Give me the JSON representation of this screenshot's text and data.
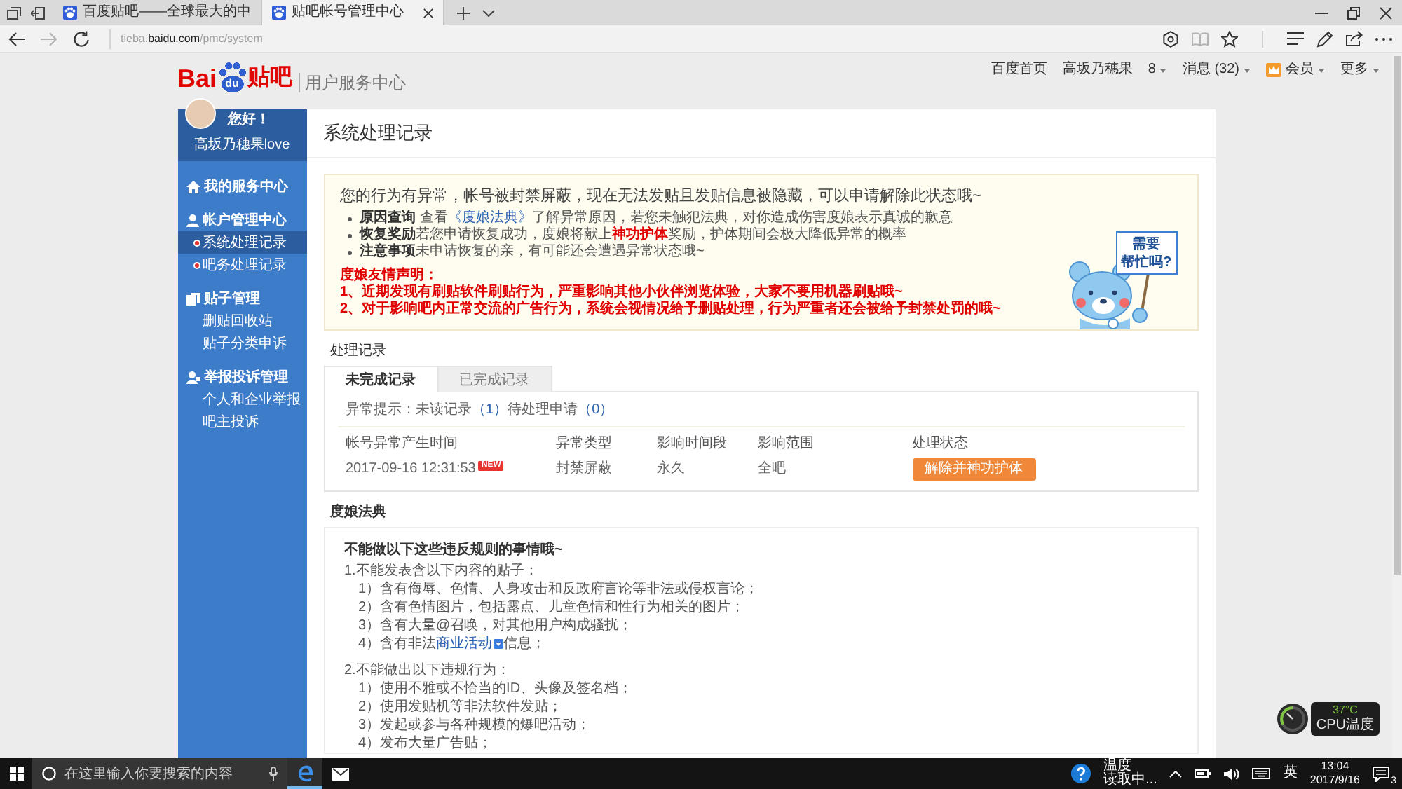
{
  "browser": {
    "tabs": [
      {
        "title": "百度贴吧——全球最大的中",
        "selected": false
      },
      {
        "title": "贴吧帐号管理中心",
        "selected": true
      }
    ],
    "nav_buttons": [
      {
        "kind": "back",
        "disabled": false
      },
      {
        "kind": "forward",
        "disabled": true
      },
      {
        "kind": "refresh",
        "disabled": false
      }
    ],
    "address": [
      {
        "text": "tieba.",
        "emphasis": false
      },
      {
        "text": "baidu.com",
        "emphasis": true
      },
      {
        "text": "/pmc/system",
        "emphasis": false
      }
    ],
    "toolbar": [
      {
        "kind": "extension",
        "disabled": false
      },
      {
        "kind": "reading_view",
        "disabled": true
      },
      {
        "kind": "favorite",
        "disabled": false
      },
      {
        "kind": "hub",
        "disabled": false
      },
      {
        "kind": "note",
        "disabled": false
      },
      {
        "kind": "share",
        "disabled": false
      },
      {
        "kind": "more",
        "disabled": false
      }
    ]
  },
  "header": {
    "logo": {
      "left": "Bai",
      "paw": "du",
      "right": "贴吧"
    },
    "subtitle": "用户服务中心",
    "links": [
      {
        "label": "百度首页",
        "kind": "plain"
      },
      {
        "label": "高坂乃穗果",
        "kind": "plain"
      },
      {
        "label": "8",
        "kind": "dropdown"
      },
      {
        "label": "消息 (32)",
        "kind": "dropdown"
      },
      {
        "label": "会员",
        "kind": "member"
      },
      {
        "label": "更多",
        "kind": "dropdown"
      }
    ]
  },
  "sidebar": {
    "greeting": "您好！",
    "username": "高坂乃穗果love",
    "sections": [
      {
        "title": "我的服务中心",
        "kind": "home"
      },
      {
        "title": "帐户管理中心",
        "kind": "account",
        "children": [
          {
            "label": "系统处理记录",
            "selected": true,
            "dot": true
          },
          {
            "label": "吧务处理记录",
            "selected": false,
            "dot": true
          }
        ]
      },
      {
        "title": "贴子管理",
        "kind": "posts",
        "children": [
          {
            "label": "删贴回收站",
            "selected": false,
            "dot": false
          },
          {
            "label": "贴子分类申诉",
            "selected": false,
            "dot": false
          }
        ]
      },
      {
        "title": "举报投诉管理",
        "kind": "report",
        "children": [
          {
            "label": "个人和企业举报",
            "selected": false,
            "dot": false
          },
          {
            "label": "吧主投诉",
            "selected": false,
            "dot": false
          }
        ]
      }
    ]
  },
  "main": {
    "title": "系统处理记录",
    "notice": {
      "headline": "您的行为有异常，帐号被封禁屏蔽，现在无法发贴且发贴信息被隐藏，可以申请解除此状态哦~",
      "bullets": [
        {
          "title": "原因查询",
          "parts": [
            {
              "text": " 查看",
              "kind": "plain"
            },
            {
              "text": "《度娘法典》",
              "kind": "link"
            },
            {
              "text": "了解异常原因，若您未触犯法典，对你造成伤害度娘表示真诚的歉意",
              "kind": "plain"
            }
          ]
        },
        {
          "title": "恢复奖励",
          "parts": [
            {
              "text": "若您申请恢复成功，度娘将献上",
              "kind": "plain"
            },
            {
              "text": "神功护体",
              "kind": "highlight"
            },
            {
              "text": "奖励，护体期间会极大降低异常的概率",
              "kind": "plain"
            }
          ]
        },
        {
          "title": "注意事项",
          "parts": [
            {
              "text": "未申请恢复的亲，有可能还会遭遇异常状态哦~",
              "kind": "plain"
            }
          ]
        }
      ],
      "statement_title": "度娘友情声明：",
      "statements": [
        "1、近期发现有刷贴软件刷贴行为，严重影响其他小伙伴浏览体验，大家不要用机器刷贴哦~",
        "2、对于影响吧内正常交流的广告行为，系统会视情况给予删贴处理，行为严重者还会被给予封禁处罚的哦~"
      ],
      "mascot_sign": [
        "需要",
        "帮忙吗?"
      ]
    },
    "records": {
      "heading": "处理记录",
      "tabs": [
        {
          "label": "未完成记录",
          "selected": true
        },
        {
          "label": "已完成记录",
          "selected": false
        }
      ],
      "summary": [
        {
          "text": "异常提示：未读记录",
          "kind": "plain"
        },
        {
          "text": "（1）",
          "kind": "count"
        },
        {
          "text": "待处理申请",
          "kind": "plain"
        },
        {
          "text": "（0）",
          "kind": "count"
        }
      ],
      "columns": [
        "帐号异常产生时间",
        "异常类型",
        "影响时间段",
        "影响范围",
        "处理状态"
      ],
      "rows": [
        {
          "cells": [
            "2017-09-16 12:31:53",
            "封禁屏蔽",
            "永久",
            "全吧"
          ],
          "badge": "NEW",
          "action": "解除并神功护体"
        }
      ]
    },
    "rules": {
      "heading": "度娘法典",
      "intro": "不能做以下这些违反规则的事情哦~",
      "groups": [
        {
          "title": "1.不能发表含以下内容的贴子：",
          "items": [
            {
              "parts": [
                {
                  "text": "1）含有侮辱、色情、人身攻击和反政府言论等非法或侵权言论；",
                  "kind": "plain"
                }
              ]
            },
            {
              "parts": [
                {
                  "text": "2）含有色情图片，包括露点、儿童色情和性行为相关的图片；",
                  "kind": "plain"
                }
              ]
            },
            {
              "parts": [
                {
                  "text": "3）含有大量@召唤，对其他用户构成骚扰；",
                  "kind": "plain"
                }
              ]
            },
            {
              "parts": [
                {
                  "text": "4）含有非法",
                  "kind": "plain"
                },
                {
                  "text": "商业活动",
                  "kind": "menu_link"
                },
                {
                  "text": "信息；",
                  "kind": "plain"
                }
              ]
            }
          ]
        },
        {
          "title": "2.不能做出以下违规行为：",
          "items": [
            {
              "parts": [
                {
                  "text": "1）使用不雅或不恰当的ID、头像及签名档；",
                  "kind": "plain"
                }
              ]
            },
            {
              "parts": [
                {
                  "text": "2）使用发贴机等非法软件发贴；",
                  "kind": "plain"
                }
              ]
            },
            {
              "parts": [
                {
                  "text": "3）发起或参与各种规模的爆吧活动；",
                  "kind": "plain"
                }
              ]
            },
            {
              "parts": [
                {
                  "text": "4）发布大量广告贴；",
                  "kind": "plain"
                }
              ]
            }
          ]
        }
      ]
    }
  },
  "taskbar": {
    "search_placeholder": "在这里输入你要搜索的内容",
    "apps": [
      {
        "kind": "edge",
        "selected": true
      },
      {
        "kind": "mail",
        "selected": false
      }
    ],
    "weather": {
      "title": "温度",
      "status": "读取中..."
    },
    "ime": "英",
    "time": "13:04",
    "date": "2017/9/16",
    "notifications": "3"
  },
  "cpu_widget": {
    "reading": "37°C",
    "label": "CPU温度"
  }
}
